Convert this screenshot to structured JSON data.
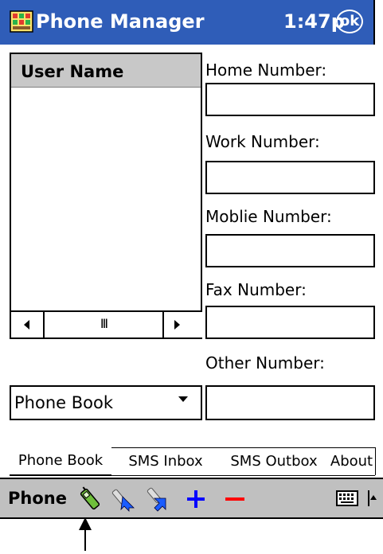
{
  "titlebar": {
    "app_title": "Phone Manager",
    "clock": "1:47p",
    "ok_label": "ok",
    "app_icon": "phone-manager-icon"
  },
  "user_list": {
    "header": "User Name",
    "scroll_thumb": "III"
  },
  "fields": {
    "home_label": "Home Number:",
    "work_label": "Work Number:",
    "mobile_label": "Moblie Number:",
    "fax_label": "Fax Number:",
    "other_label": "Other Number:"
  },
  "combo": {
    "value": "Phone Book"
  },
  "tabs": [
    {
      "label": "Phone Book"
    },
    {
      "label": "SMS Inbox"
    },
    {
      "label": "SMS Outbox"
    },
    {
      "label": "About"
    }
  ],
  "toolbar": {
    "label": "Phone",
    "icons": [
      "phone-icon",
      "dial-out-icon",
      "dial-in-icon",
      "add-icon",
      "remove-icon",
      "keyboard-icon"
    ]
  },
  "colors": {
    "titlebar": "#2f5db8",
    "toolbar": "#c0c0c0",
    "add": "#0000ff",
    "remove": "#ff0000"
  }
}
